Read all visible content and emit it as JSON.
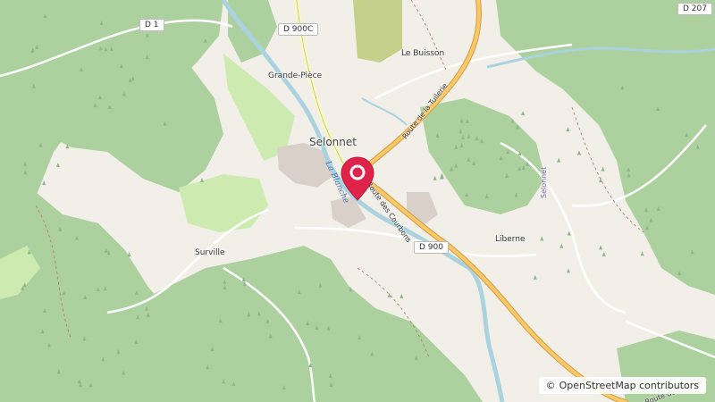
{
  "map": {
    "places": {
      "selonnet": "Selonnet",
      "le_buisson": "Le Buisson",
      "grande_piece": "Grande-Pièce",
      "surville": "Surville",
      "liberne": "Liberne",
      "selonnet_vertical": "Selonnet"
    },
    "roads": {
      "d1": "D 1",
      "d900c": "D 900C",
      "d900": "D 900",
      "d207": "D 207",
      "route_tuilerie": "Route de la Tuilerie",
      "route_courbons": "Route des Courbons",
      "route_bellevue": "Route de Bellevue"
    },
    "water": {
      "la_blanche": "La Blanche"
    },
    "attribution": {
      "symbol": "©",
      "text": "OpenStreetMap contributors"
    },
    "colors": {
      "forest": "#add19e",
      "background": "#f2efe9",
      "meadow": "#cdebb0",
      "river": "#aad3df",
      "primary_road": "#f9c86a",
      "marker": "#e0234b"
    },
    "marker_icon": "map-pin-icon"
  }
}
